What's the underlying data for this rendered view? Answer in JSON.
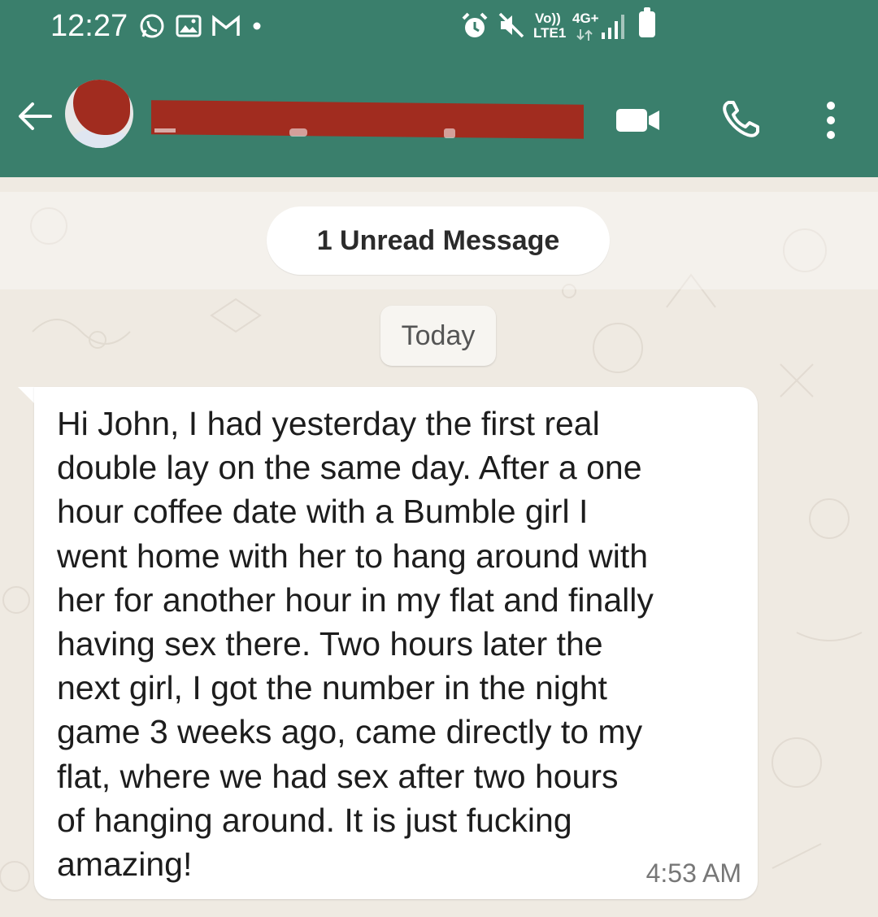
{
  "status_bar": {
    "time": "12:27",
    "left_icons": [
      "whatsapp-icon",
      "gallery-icon",
      "gmail-icon",
      "notification-dot-icon"
    ],
    "right_icons": [
      "alarm-icon",
      "mute-icon",
      "volte-icon",
      "4g-icon",
      "signal-icon",
      "battery-icon"
    ],
    "volte_label": "Vo))",
    "lte_label": "LTE1",
    "network_label": "4G+"
  },
  "header": {
    "contact_name": "",
    "actions": [
      "video-call-icon",
      "voice-call-icon",
      "more-options-icon"
    ]
  },
  "chat": {
    "unread_label": "1 Unread Message",
    "date_label": "Today",
    "messages": [
      {
        "text": "Hi John, I had yesterday the first real\ndouble lay on the same day. After a one\nhour coffee date with a Bumble girl I\nwent home with her to hang around with\nher for another hour in my flat and finally\nhaving sex there. Two hours later the\nnext girl, I got the number in the night\ngame 3 weeks ago, came directly to my\nflat, where we had sex after two hours\nof hanging around. It is just fucking\namazing!",
        "time": "4:53 AM"
      }
    ]
  },
  "colors": {
    "header": "#3A7F6C",
    "chat_background": "#EFEAE2",
    "bubble": "#FFFFFF",
    "redaction": "#A12C1F"
  }
}
